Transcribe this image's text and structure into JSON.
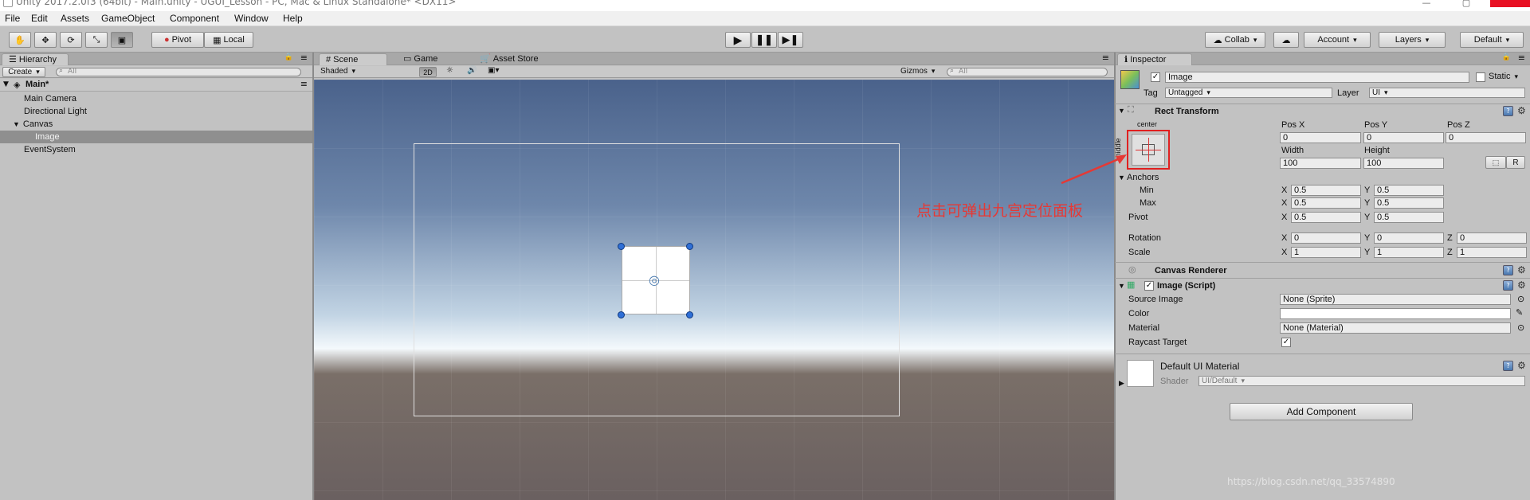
{
  "window": {
    "title": "Unity 2017.2.0f3 (64bit) - Main.unity - UGUI_Lesson - PC, Mac & Linux Standalone* <DX11>"
  },
  "menu": [
    "File",
    "Edit",
    "Assets",
    "GameObject",
    "Component",
    "Window",
    "Help"
  ],
  "toolbar": {
    "pivot": "Pivot",
    "local": "Local",
    "collab": "Collab",
    "account": "Account",
    "layers": "Layers",
    "layout": "Default"
  },
  "hierarchy": {
    "tab": "Hierarchy",
    "create": "Create",
    "search_placeholder": "All",
    "scene": "Main*",
    "items": [
      "Main Camera",
      "Directional Light",
      "Canvas",
      "Image",
      "EventSystem"
    ]
  },
  "scene_panel": {
    "tabs": [
      "Scene",
      "Game",
      "Asset Store"
    ],
    "shading": "Shaded",
    "mode_2d": "2D",
    "gizmos": "Gizmos",
    "search_placeholder": "All"
  },
  "inspector": {
    "tab": "Inspector",
    "object_name": "Image",
    "static_label": "Static",
    "tag_label": "Tag",
    "tag_value": "Untagged",
    "layer_label": "Layer",
    "layer_value": "UI",
    "rect_transform": {
      "title": "Rect Transform",
      "anchor_h": "center",
      "anchor_v": "middle",
      "pos_x_label": "Pos X",
      "pos_y_label": "Pos Y",
      "pos_z_label": "Pos Z",
      "pos_x": "0",
      "pos_y": "0",
      "pos_z": "0",
      "width_label": "Width",
      "height_label": "Height",
      "width": "100",
      "height": "100",
      "r_button": "R",
      "anchors_label": "Anchors",
      "min_label": "Min",
      "max_label": "Max",
      "min_x": "0.5",
      "min_y": "0.5",
      "max_x": "0.5",
      "max_y": "0.5",
      "pivot_label": "Pivot",
      "pivot_x": "0.5",
      "pivot_y": "0.5",
      "rotation_label": "Rotation",
      "rot_x": "0",
      "rot_y": "0",
      "rot_z": "0",
      "scale_label": "Scale",
      "scale_x": "1",
      "scale_y": "1",
      "scale_z": "1",
      "x": "X",
      "y": "Y",
      "z": "Z"
    },
    "canvas_renderer": {
      "title": "Canvas Renderer"
    },
    "image_script": {
      "title": "Image (Script)",
      "source_image_label": "Source Image",
      "source_image": "None (Sprite)",
      "color_label": "Color",
      "material_label": "Material",
      "material": "None (Material)",
      "raycast_label": "Raycast Target"
    },
    "material": {
      "name": "Default UI Material",
      "shader_label": "Shader",
      "shader": "UI/Default"
    },
    "add_component": "Add Component"
  },
  "annotation": {
    "text": "点击可弹出九宫定位面板",
    "color": "#e53935"
  },
  "watermark": "https://blog.csdn.net/qq_33574890"
}
